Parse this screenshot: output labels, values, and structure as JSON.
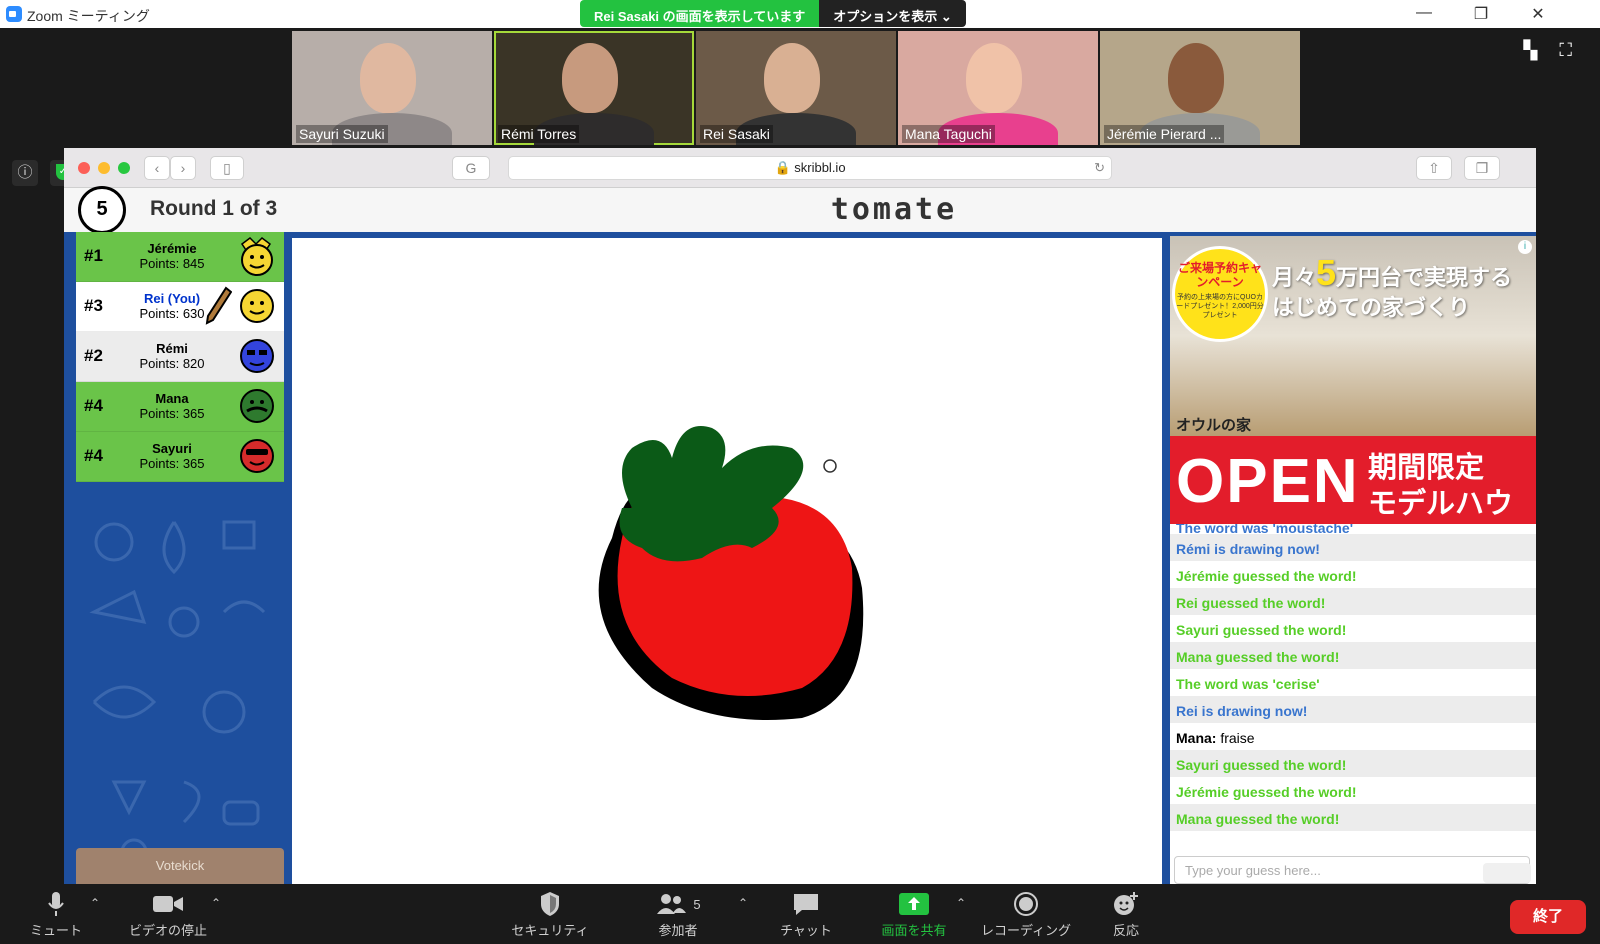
{
  "window": {
    "title": "Zoom ミーティング"
  },
  "share_banner": {
    "status": "Rei Sasaki の画面を表示しています",
    "options": "オプションを表示 ⌄"
  },
  "videos": [
    {
      "name": "Sayuri Suzuki"
    },
    {
      "name": "Rémi Torres"
    },
    {
      "name": "Rei Sasaki"
    },
    {
      "name": "Mana Taguchi"
    },
    {
      "name": "Jérémie Pierard ..."
    }
  ],
  "browser": {
    "url": "skribbl.io"
  },
  "game": {
    "timer": "5",
    "round": "Round 1 of 3",
    "word": "tomate",
    "votekick": "Votekick",
    "players": [
      {
        "rank": "#1",
        "name": "Jérémie",
        "points": "Points: 845",
        "color": "#f6d633"
      },
      {
        "rank": "#3",
        "name": "Rei (You)",
        "points": "Points: 630",
        "color": "#f6d633"
      },
      {
        "rank": "#2",
        "name": "Rémi",
        "points": "Points: 820",
        "color": "#3344dd"
      },
      {
        "rank": "#4",
        "name": "Mana",
        "points": "Points: 365",
        "color": "#2e7a2e"
      },
      {
        "rank": "#4",
        "name": "Sayuri",
        "points": "Points: 365",
        "color": "#d62b2b"
      }
    ]
  },
  "ad": {
    "campaign": "ご来場予約キャンペーン",
    "campaign_sub": "予約の上来場の方にQUOカードプレゼント！2,000円分プレゼント",
    "headline_pre": "月々",
    "headline_big": "5",
    "headline_post": "万円台で実現する",
    "headline_line2": "はじめての家づくり",
    "brand": "オウルの家",
    "open": "OPEN",
    "limited_1": "期間限定",
    "limited_2": "モデルハウス"
  },
  "chat": {
    "cut_message": "The word was 'moustache'",
    "messages": [
      {
        "text": "Rémi is drawing now!",
        "style": "blue"
      },
      {
        "text": "Jérémie guessed the word!",
        "style": "green"
      },
      {
        "text": "Rei guessed the word!",
        "style": "green"
      },
      {
        "text": "Sayuri guessed the word!",
        "style": "green"
      },
      {
        "text": "Mana guessed the word!",
        "style": "green"
      },
      {
        "text": "The word was 'cerise'",
        "style": "green"
      },
      {
        "text": "Rei is drawing now!",
        "style": "blue"
      },
      {
        "author": "Mana:",
        "text": " fraise",
        "style": "normal"
      },
      {
        "text": "Sayuri guessed the word!",
        "style": "green"
      },
      {
        "text": "Jérémie guessed the word!",
        "style": "green"
      },
      {
        "text": "Mana guessed the word!",
        "style": "green"
      }
    ],
    "placeholder": "Type your guess here..."
  },
  "bottombar": {
    "mute": "ミュート",
    "video": "ビデオの停止",
    "security": "セキュリティ",
    "participants": "参加者",
    "participants_count": "5",
    "chat": "チャット",
    "share": "画面を共有",
    "record": "レコーディング",
    "reactions": "反応",
    "end": "終了"
  },
  "colors": {
    "zoom_green": "#23c240",
    "skribbl_blue": "#1e4f9e",
    "tomato_red": "#ee1515",
    "leaf_green": "#0b5a17",
    "guess_green": "#56ce27",
    "draw_blue": "#3975ce",
    "end_red": "#e02828"
  }
}
